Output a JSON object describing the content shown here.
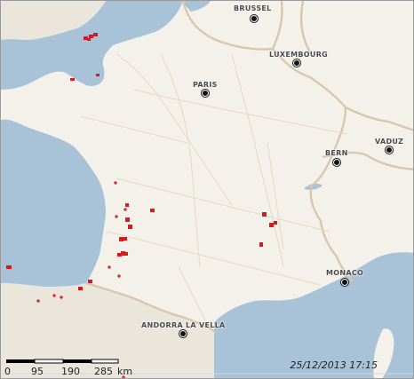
{
  "map": {
    "cities": [
      {
        "id": "brussel",
        "name": "BRUSSEL"
      },
      {
        "id": "luxembourg",
        "name": "LUXEMBOURG"
      },
      {
        "id": "paris",
        "name": "PARIS"
      },
      {
        "id": "bern",
        "name": "BERN"
      },
      {
        "id": "vaduz",
        "name": "VADUZ"
      },
      {
        "id": "monaco",
        "name": "MONACO"
      },
      {
        "id": "andorra",
        "name": "ANDORRA LA VELLA"
      }
    ],
    "scale": {
      "labels": [
        "0",
        "95",
        "190",
        "285"
      ],
      "unit": "km"
    },
    "timestamp": "25/12/2013 17:15",
    "colors": {
      "sea": "#a8c2d8",
      "land": "#f4f1ea",
      "outside_land": "#eae6dc",
      "border": "#d8c7ad",
      "detection": "#e0161b"
    }
  }
}
